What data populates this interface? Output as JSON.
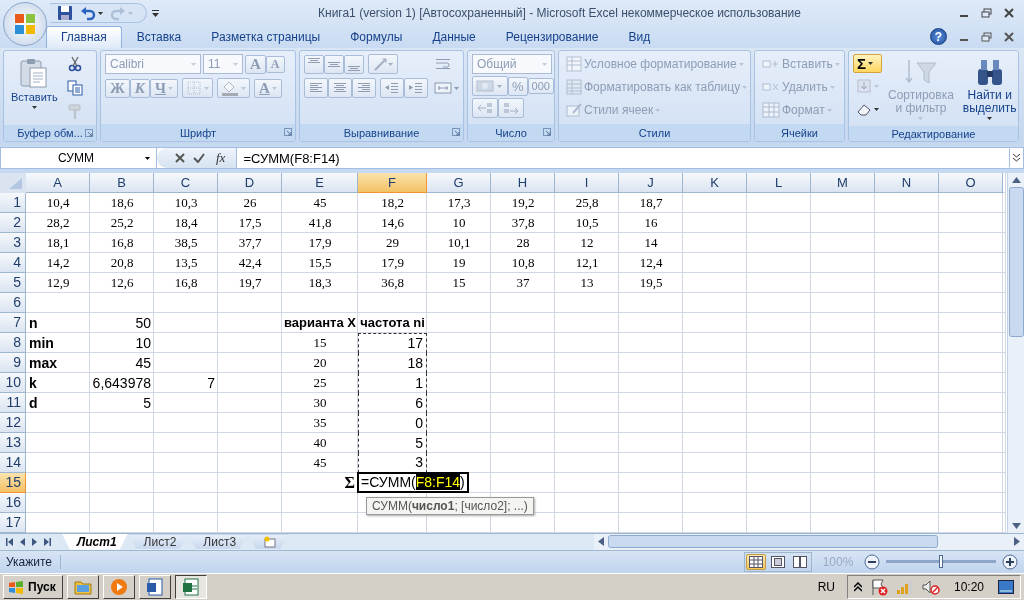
{
  "title_bar": {
    "title": "Книга1 (version 1) [Автосохраненный] - Microsoft Excel некоммерческое использование",
    "quick_access": [
      {
        "kind": "save",
        "disabled": false
      },
      {
        "kind": "undo",
        "disabled": false
      },
      {
        "kind": "redo",
        "disabled": true
      },
      {
        "kind": "customize",
        "disabled": false
      }
    ]
  },
  "tabs": [
    {
      "label": "Главная",
      "selected": true
    },
    {
      "label": "Вставка",
      "selected": false
    },
    {
      "label": "Разметка страницы",
      "selected": false
    },
    {
      "label": "Формулы",
      "selected": false
    },
    {
      "label": "Данные",
      "selected": false
    },
    {
      "label": "Рецензирование",
      "selected": false
    },
    {
      "label": "Вид",
      "selected": false
    }
  ],
  "help": "?",
  "ribbon_groups": [
    {
      "kind": "clipboard",
      "label": "Буфер обм...",
      "launcher": true,
      "items": [
        {
          "kind": "paste",
          "label": "Вставить",
          "disabled": false
        },
        {
          "kind": "cut",
          "disabled": false
        },
        {
          "kind": "copy",
          "disabled": false
        },
        {
          "kind": "painter",
          "disabled": true
        }
      ]
    },
    {
      "kind": "font",
      "label": "Шрифт",
      "launcher": true,
      "items": [
        {
          "kind": "font_name",
          "value": "Calibri",
          "disabled": true
        },
        {
          "kind": "font_size",
          "value": "11",
          "disabled": true
        },
        {
          "kind": "grow",
          "label": "A",
          "disabled": true
        },
        {
          "kind": "shrink",
          "label": "A",
          "disabled": true
        },
        {
          "kind": "bold",
          "label": "Ж",
          "disabled": true
        },
        {
          "kind": "italic",
          "label": "К",
          "disabled": true
        },
        {
          "kind": "underline",
          "label": "Ч",
          "disabled": true
        },
        {
          "kind": "borders",
          "disabled": true
        },
        {
          "kind": "fill",
          "disabled": true
        },
        {
          "kind": "font_color",
          "label": "A",
          "disabled": true
        }
      ]
    },
    {
      "kind": "alignment",
      "label": "Выравнивание",
      "launcher": true,
      "items": [
        {
          "kind": "top",
          "disabled": true
        },
        {
          "kind": "middle",
          "disabled": true
        },
        {
          "kind": "bottom",
          "disabled": true
        },
        {
          "kind": "orientation",
          "disabled": true
        },
        {
          "kind": "left",
          "disabled": true
        },
        {
          "kind": "center",
          "disabled": true
        },
        {
          "kind": "right",
          "disabled": true
        },
        {
          "kind": "outdent",
          "disabled": true
        },
        {
          "kind": "indent",
          "disabled": true
        },
        {
          "kind": "wrap",
          "disabled": true
        },
        {
          "kind": "merge",
          "disabled": true
        }
      ]
    },
    {
      "kind": "number",
      "label": "Число",
      "launcher": true,
      "items": [
        {
          "kind": "format",
          "value": "Общий",
          "disabled": true
        },
        {
          "kind": "currency",
          "disabled": true
        },
        {
          "kind": "percent",
          "label": "%",
          "disabled": true
        },
        {
          "kind": "thousands",
          "label": "000",
          "disabled": true
        },
        {
          "kind": "more_decimals",
          "disabled": true
        },
        {
          "kind": "fewer_decimals",
          "disabled": true
        }
      ]
    },
    {
      "kind": "styles",
      "label": "Стили",
      "launcher": false,
      "items": [
        {
          "kind": "conditional",
          "label": "Условное форматирование",
          "disabled": true
        },
        {
          "kind": "table",
          "label": "Форматировать как таблицу",
          "disabled": true
        },
        {
          "kind": "cell_styles",
          "label": "Стили ячеек",
          "disabled": true
        }
      ]
    },
    {
      "kind": "cells",
      "label": "Ячейки",
      "launcher": false,
      "items": [
        {
          "kind": "insert",
          "label": "Вставить",
          "disabled": true
        },
        {
          "kind": "delete",
          "label": "Удалить",
          "disabled": true
        },
        {
          "kind": "format",
          "label": "Формат",
          "disabled": true
        }
      ]
    },
    {
      "kind": "editing",
      "label": "Редактирование",
      "launcher": false,
      "items": [
        {
          "kind": "autosum",
          "label": "Σ",
          "disabled": false,
          "highlighted": true
        },
        {
          "kind": "fill_down",
          "disabled": true,
          "highlighted": false
        },
        {
          "kind": "clear",
          "disabled": false,
          "highlighted": false
        },
        {
          "kind": "sort",
          "label": "Сортировка и фильтр",
          "disabled": true,
          "highlighted": false
        },
        {
          "kind": "find",
          "label": "Найти и выделить",
          "disabled": false,
          "highlighted": false
        }
      ]
    }
  ],
  "formula_bar": {
    "name_box": "СУММ",
    "function_button": "fx",
    "formula": "=СУММ(F8:F14)"
  },
  "sheet": {
    "columns": [
      {
        "label": "A",
        "selected": false
      },
      {
        "label": "B",
        "selected": false
      },
      {
        "label": "C",
        "selected": false
      },
      {
        "label": "D",
        "selected": false
      },
      {
        "label": "E",
        "selected": false
      },
      {
        "label": "F",
        "selected": true
      },
      {
        "label": "G",
        "selected": false
      },
      {
        "label": "H",
        "selected": false
      },
      {
        "label": "I",
        "selected": false
      },
      {
        "label": "J",
        "selected": false
      },
      {
        "label": "K",
        "selected": false
      },
      {
        "label": "L",
        "selected": false
      },
      {
        "label": "M",
        "selected": false
      },
      {
        "label": "N",
        "selected": false
      },
      {
        "label": "O",
        "selected": false
      }
    ],
    "rows": [
      {
        "label": "1",
        "selected": false,
        "cells": [
          {
            "text": "10,4",
            "kind": "data"
          },
          {
            "text": "18,6",
            "kind": "data"
          },
          {
            "text": "10,3",
            "kind": "data"
          },
          {
            "text": "26",
            "kind": "data"
          },
          {
            "text": "45",
            "kind": "data"
          },
          {
            "text": "18,2",
            "kind": "data"
          },
          {
            "text": "17,3",
            "kind": "data"
          },
          {
            "text": "19,2",
            "kind": "data"
          },
          {
            "text": "25,8",
            "kind": "data"
          },
          {
            "text": "18,7",
            "kind": "data"
          }
        ]
      },
      {
        "label": "2",
        "selected": false,
        "cells": [
          {
            "text": "28,2",
            "kind": "data"
          },
          {
            "text": "25,2",
            "kind": "data"
          },
          {
            "text": "18,4",
            "kind": "data"
          },
          {
            "text": "17,5",
            "kind": "data"
          },
          {
            "text": "41,8",
            "kind": "data"
          },
          {
            "text": "14,6",
            "kind": "data"
          },
          {
            "text": "10",
            "kind": "data"
          },
          {
            "text": "37,8",
            "kind": "data"
          },
          {
            "text": "10,5",
            "kind": "data"
          },
          {
            "text": "16",
            "kind": "data"
          }
        ]
      },
      {
        "label": "3",
        "selected": false,
        "cells": [
          {
            "text": "18,1",
            "kind": "data"
          },
          {
            "text": "16,8",
            "kind": "data"
          },
          {
            "text": "38,5",
            "kind": "data"
          },
          {
            "text": "37,7",
            "kind": "data"
          },
          {
            "text": "17,9",
            "kind": "data"
          },
          {
            "text": "29",
            "kind": "data"
          },
          {
            "text": "10,1",
            "kind": "data"
          },
          {
            "text": "28",
            "kind": "data"
          },
          {
            "text": "12",
            "kind": "data"
          },
          {
            "text": "14",
            "kind": "data"
          }
        ]
      },
      {
        "label": "4",
        "selected": false,
        "cells": [
          {
            "text": "14,2",
            "kind": "data"
          },
          {
            "text": "20,8",
            "kind": "data"
          },
          {
            "text": "13,5",
            "kind": "data"
          },
          {
            "text": "42,4",
            "kind": "data"
          },
          {
            "text": "15,5",
            "kind": "data"
          },
          {
            "text": "17,9",
            "kind": "data"
          },
          {
            "text": "19",
            "kind": "data"
          },
          {
            "text": "10,8",
            "kind": "data"
          },
          {
            "text": "12,1",
            "kind": "data"
          },
          {
            "text": "12,4",
            "kind": "data"
          }
        ]
      },
      {
        "label": "5",
        "selected": false,
        "cells": [
          {
            "text": "12,9",
            "kind": "data"
          },
          {
            "text": "12,6",
            "kind": "data"
          },
          {
            "text": "16,8",
            "kind": "data"
          },
          {
            "text": "19,7",
            "kind": "data"
          },
          {
            "text": "18,3",
            "kind": "data"
          },
          {
            "text": "36,8",
            "kind": "data"
          },
          {
            "text": "15",
            "kind": "data"
          },
          {
            "text": "37",
            "kind": "data"
          },
          {
            "text": "13",
            "kind": "data"
          },
          {
            "text": "19,5",
            "kind": "data"
          }
        ]
      },
      {
        "label": "6",
        "selected": false
      },
      {
        "label": "7",
        "selected": false,
        "cells": [
          {
            "text": "n",
            "kind": "label"
          },
          {
            "text": "50",
            "kind": "number"
          },
          null,
          null,
          {
            "text": "варианта X",
            "kind": "heading"
          },
          {
            "text": "частота ni",
            "kind": "heading"
          }
        ]
      },
      {
        "label": "8",
        "selected": false,
        "cells": [
          {
            "text": "min",
            "kind": "label"
          },
          {
            "text": "10",
            "kind": "number"
          },
          null,
          null,
          {
            "text": "15",
            "kind": "data"
          },
          {
            "text": "17",
            "kind": "range"
          }
        ]
      },
      {
        "label": "9",
        "selected": false,
        "cells": [
          {
            "text": "max",
            "kind": "label"
          },
          {
            "text": "45",
            "kind": "number"
          },
          null,
          null,
          {
            "text": "20",
            "kind": "data"
          },
          {
            "text": "18",
            "kind": "range"
          }
        ]
      },
      {
        "label": "10",
        "selected": false,
        "cells": [
          {
            "text": "k",
            "kind": "label"
          },
          {
            "text": "6,643978",
            "kind": "number"
          },
          {
            "text": "7",
            "kind": "number"
          },
          null,
          {
            "text": "25",
            "kind": "data"
          },
          {
            "text": "1",
            "kind": "range"
          }
        ]
      },
      {
        "label": "11",
        "selected": false,
        "cells": [
          {
            "text": "d",
            "kind": "label"
          },
          {
            "text": "5",
            "kind": "number"
          },
          null,
          null,
          {
            "text": "30",
            "kind": "data"
          },
          {
            "text": "6",
            "kind": "range"
          }
        ]
      },
      {
        "label": "12",
        "selected": false,
        "cells": [
          null,
          null,
          null,
          null,
          {
            "text": "35",
            "kind": "data"
          },
          {
            "text": "0",
            "kind": "range"
          }
        ]
      },
      {
        "label": "13",
        "selected": false,
        "cells": [
          null,
          null,
          null,
          null,
          {
            "text": "40",
            "kind": "data"
          },
          {
            "text": "5",
            "kind": "range"
          }
        ]
      },
      {
        "label": "14",
        "selected": false,
        "cells": [
          null,
          null,
          null,
          null,
          {
            "text": "45",
            "kind": "data"
          },
          {
            "text": "3",
            "kind": "range"
          }
        ]
      },
      {
        "label": "15",
        "selected": true,
        "cells": [
          null,
          null,
          null,
          null,
          {
            "text": "Σ",
            "kind": "sigma"
          },
          {
            "kind": "edit",
            "text": "=СУММ(",
            "reference": "F8:F14",
            "closing": ")",
            "tooltip": "СУММ(**число1**; [число2]; ...)"
          }
        ]
      },
      {
        "label": "16",
        "selected": false
      },
      {
        "label": "17",
        "selected": false
      }
    ]
  },
  "sheet_tabs": [
    {
      "label": "Лист1",
      "selected": true
    },
    {
      "label": "Лист2",
      "selected": false
    },
    {
      "label": "Лист3",
      "selected": false
    }
  ],
  "status_bar": {
    "mode": "Укажите",
    "views": [
      {
        "kind": "normal",
        "selected": true
      },
      {
        "kind": "layout",
        "selected": false
      },
      {
        "kind": "page_break",
        "selected": false
      }
    ],
    "zoom_label": "100%",
    "zoom": {
      "level": 0.5
    }
  },
  "taskbar": {
    "start": "Пуск",
    "apps": [
      {
        "kind": "folder",
        "selected": false
      },
      {
        "kind": "player",
        "selected": false
      },
      {
        "kind": "document",
        "selected": false
      },
      {
        "kind": "spreadsheet",
        "selected": true
      }
    ],
    "language": "RU",
    "clock": "10:20"
  }
}
